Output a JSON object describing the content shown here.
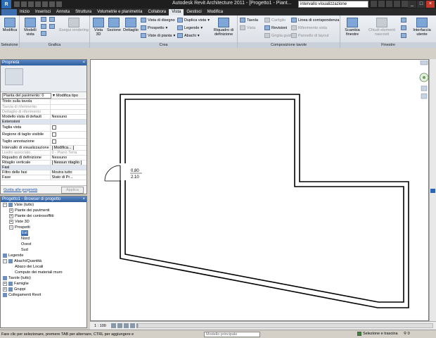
{
  "titlebar": {
    "app_icon": "R",
    "title": "Autodesk Revit Architecture 2011 - [Progetto1 - Piant...",
    "search_value": "intervallo visualizzazione",
    "colors": {
      "bar": "#1e1e1e",
      "accent": "#3d6eb0"
    }
  },
  "tabs": [
    {
      "label": ""
    },
    {
      "label": "Inizio"
    },
    {
      "label": "Inserisci"
    },
    {
      "label": "Annota"
    },
    {
      "label": "Struttura"
    },
    {
      "label": "Volumetrie e planimetria"
    },
    {
      "label": "Collabora"
    },
    {
      "label": "Vista"
    },
    {
      "label": "Gestisci"
    },
    {
      "label": "Modifica"
    }
  ],
  "ribbon": {
    "selezione": {
      "title": "Selezione",
      "modifica": "Modifica"
    },
    "grafica": {
      "title": "Grafica",
      "modelli_vista": "Modelli vista",
      "esegui_rendering": "Esegui rendering"
    },
    "crea": {
      "title": "Crea",
      "vista3d": "Vista 3D",
      "sezione": "Sezione",
      "dettaglio": "Dettaglio",
      "vista_disegno": "Vista di disegno",
      "prospetto": "Prospetto",
      "viste_pianta": "Viste di pianta",
      "duplica_vista": "Duplica vista",
      "legende": "Legende",
      "abachi": "Abachi",
      "riquadro": "Riquadro di definizione"
    },
    "composizione": {
      "title": "Composizione tavole",
      "tavola": "Tavola",
      "vista": "Vista",
      "cartiglio": "Cartiglio",
      "revisioni": "Revisioni",
      "griglia_guida": "Griglia guida",
      "linea_corrispondenza": "Linea di corrispondenza",
      "riferimento_vista": "Riferimento vista",
      "pannello_layout": "Pannello di layout"
    },
    "finestre": {
      "title": "Finestre",
      "scambia": "Scambia finestre",
      "chiudi": "Chiudi elementi nascosti",
      "interfaccia": "Interfaccia utente"
    }
  },
  "properties": {
    "header": "Proprietà",
    "close": "×",
    "type_selector": "Pianta del pavimento: 0",
    "edit_type": "Modifica tipo",
    "rows": [
      {
        "k": "Titolo sulla tavola",
        "v": "",
        "kind": "text"
      },
      {
        "k": "Tavola di riferimento",
        "v": "",
        "kind": "dis"
      },
      {
        "k": "Dettaglio di riferimento",
        "v": "",
        "kind": "dis"
      },
      {
        "k": "Modello vista di default",
        "v": "Nessuno",
        "kind": "text"
      },
      {
        "k": "Estensioni",
        "v": "",
        "kind": "group"
      },
      {
        "k": "Taglia vista",
        "v": "",
        "kind": "check"
      },
      {
        "k": "Regione di taglio visibile",
        "v": "",
        "kind": "check"
      },
      {
        "k": "Taglio annotazione",
        "v": "",
        "kind": "check"
      },
      {
        "k": "Intervallo di visualizzazione",
        "v": "Modifica...",
        "kind": "button"
      },
      {
        "k": "Livello associato",
        "v": "0 - Piano Terra",
        "kind": "dis"
      },
      {
        "k": "Riquadro di definizione",
        "v": "Nessuno",
        "kind": "text"
      },
      {
        "k": "Ritaglio verticale",
        "v": "Nessun ritaglio",
        "kind": "button"
      },
      {
        "k": "Fasi",
        "v": "",
        "kind": "group"
      },
      {
        "k": "Filtro delle fasi",
        "v": "Mostra tutto",
        "kind": "text"
      },
      {
        "k": "Fase",
        "v": "Stato di Pr...",
        "kind": "text"
      }
    ],
    "help_link": "Guida alle proprietà",
    "apply": "Applica"
  },
  "browser": {
    "header": "Progetto1 - Browser di progetto",
    "close": "×",
    "items": [
      {
        "label": "Viste (tutto)",
        "level": 0,
        "exp": "−",
        "icon": true
      },
      {
        "label": "Piante dei pavimenti",
        "level": 1,
        "exp": "+",
        "icon": false
      },
      {
        "label": "Piante dei controsoffitti",
        "level": 1,
        "exp": "+",
        "icon": false
      },
      {
        "label": "Viste 3D",
        "level": 1,
        "exp": "+",
        "icon": false
      },
      {
        "label": "Prospetti",
        "level": 1,
        "exp": "−",
        "icon": false
      },
      {
        "label": "Est",
        "level": 2,
        "exp": "",
        "icon": false,
        "selected": true
      },
      {
        "label": "Nord",
        "level": 2,
        "exp": "",
        "icon": false
      },
      {
        "label": "Ovest",
        "level": 2,
        "exp": "",
        "icon": false
      },
      {
        "label": "Sud",
        "level": 2,
        "exp": "",
        "icon": false
      },
      {
        "label": "Legende",
        "level": 0,
        "exp": "",
        "icon": true
      },
      {
        "label": "Abachi/Quantità",
        "level": 0,
        "exp": "−",
        "icon": true
      },
      {
        "label": "Abaco dei Locali",
        "level": 1,
        "exp": "",
        "icon": false
      },
      {
        "label": "Computo dei materiali muro",
        "level": 1,
        "exp": "",
        "icon": false
      },
      {
        "label": "Tavole (tutto)",
        "level": 0,
        "exp": "",
        "icon": true
      },
      {
        "label": "Famiglie",
        "level": 0,
        "exp": "+",
        "icon": true
      },
      {
        "label": "Gruppi",
        "level": 0,
        "exp": "+",
        "icon": true
      },
      {
        "label": "Collegamenti Revit",
        "level": 0,
        "exp": "",
        "icon": true
      }
    ]
  },
  "drawing": {
    "door_tag_top": "0.80",
    "door_tag_bottom": "2.10"
  },
  "viewbar": {
    "scale": "1 : 100"
  },
  "status": {
    "message": "Fare clic per selezionare, premere TAB per alternare, CTRL per aggiungere e",
    "model": "Modello principale",
    "select_drag": "Selezione e trascina",
    "filter_count": "0"
  }
}
